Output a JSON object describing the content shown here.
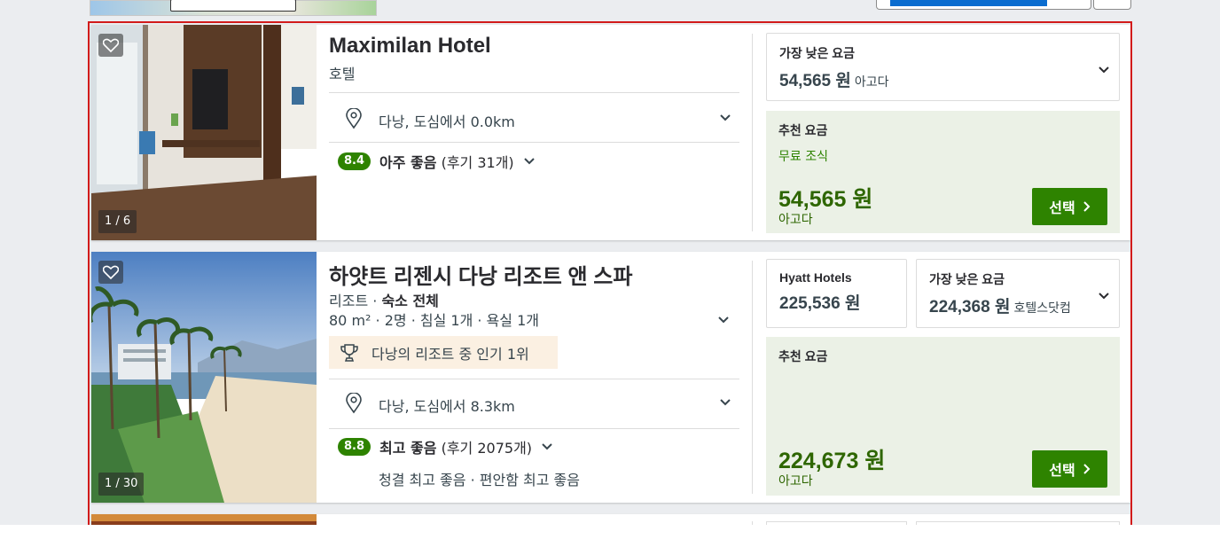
{
  "colors": {
    "accent_green": "#2e8300",
    "frame_red": "#d21b1b",
    "rec_bg": "#ebf1e6",
    "award_bg": "#fbf0e2"
  },
  "hotels": [
    {
      "name": "Maximilan Hotel",
      "type": "호텔",
      "location": "다낭, 도심에서 0.0km",
      "rating": "8.4",
      "rating_word": "아주 좋음",
      "reviews": "(후기 31개)",
      "photo_counter": "1 / 6",
      "lowest_label": "가장 낮은 요금",
      "lowest_price": "54,565 원",
      "lowest_provider": "아고다",
      "rec_label": "추천 요금",
      "rec_perk": "무료 조식",
      "rec_price": "54,565 원",
      "rec_provider": "아고다",
      "select_label": "선택"
    },
    {
      "name": "하얏트 리젠시 다낭 리조트 앤 스파",
      "type": "리조트",
      "type_extra": "숙소 전체",
      "room_info": "80 m² · 2명 · 침실 1개 · 욕실 1개",
      "award": "다낭의 리조트 중 인기 1위",
      "location": "다낭, 도심에서 8.3km",
      "rating": "8.8",
      "rating_word": "최고 좋음",
      "reviews": "(후기 2075개)",
      "sub_scores": "청결 최고 좋음 · 편안함 최고 좋음",
      "photo_counter": "1 / 30",
      "brand_label": "Hyatt Hotels",
      "brand_price": "225,536 원",
      "lowest_label": "가장 낮은 요금",
      "lowest_price": "224,368 원",
      "lowest_provider": "호텔스닷컴",
      "rec_label": "추천 요금",
      "rec_price": "224,673 원",
      "rec_provider": "아고다",
      "select_label": "선택"
    }
  ],
  "separator_dot": "·"
}
